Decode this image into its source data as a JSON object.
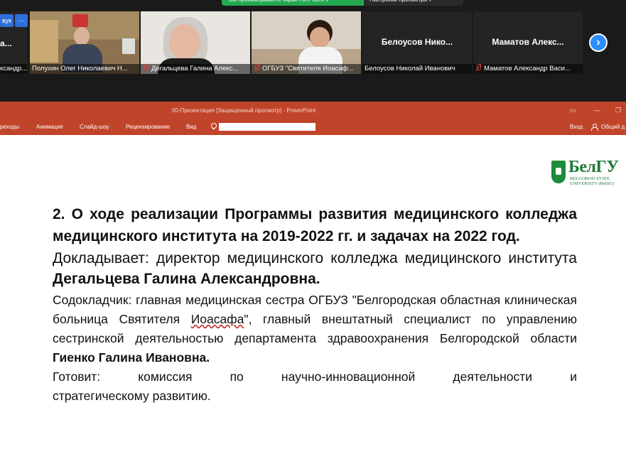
{
  "zoom": {
    "share_banner": "Вы просматриваете экран НИУ БелГУ",
    "view_options": "Настройки просмотра ▾",
    "top_left_btn": "вук",
    "top_left_more": "···",
    "side_tile_partial_top": "а...",
    "side_tile_partial_name": "ксандр...",
    "tiles": [
      {
        "name": "Полухин Олег Николаевич Н...",
        "muted": false,
        "active": true
      },
      {
        "name": "Дегальцева Галина Алекс...",
        "muted": true,
        "active": false
      },
      {
        "name": "ОГБУЗ \"Святителя Иоасаф...",
        "muted": true,
        "active": false
      },
      {
        "name": "Белоусов Николай Иванович",
        "center_label": "Белоусов Нико...",
        "muted": false,
        "active": false
      },
      {
        "name": "Маматов Александр Васи...",
        "center_label": "Маматов Алекс...",
        "muted": true,
        "active": false
      }
    ],
    "next_icon": "›"
  },
  "powerpoint": {
    "title": "00-Презентация [Защищенный просмотр] - PowerPoint",
    "ribbon_tabs": [
      "реходы",
      "Анимация",
      "Слайд-шоу",
      "Рецензирование",
      "Вид"
    ],
    "signin": "Вход",
    "share": "Общий д",
    "accent_color": "#c0442a"
  },
  "slide": {
    "logo": {
      "nriu": "НИУ",
      "main": "БелГУ",
      "sub": "BELGOROD STATE UNIVERSITY (BelSU)"
    },
    "heading": "2. О ходе реализации Программы развития медицинского колледжа медицинского института на 2019-2022 гг. и задачах на 2022 год.",
    "reporter_prefix": "Докладывает: директор медицинского колледжа медицинского института ",
    "reporter_name": "Дегальцева Галина Александровна.",
    "co_reporter_prefix": "Содокладчик: главная медицинская сестра ОГБУЗ \"Белгородская областная клиническая больница Святителя ",
    "co_reporter_saint": "Иоасафа",
    "co_reporter_mid": "\", главный внештатный специалист по управлению сестринской деятельностью департамента здравоохранения Белгородской области ",
    "co_reporter_name": "Гиенко Галина Ивановна.",
    "prepares_line1": "Готовит: комиссия по научно-инновационной деятельности и",
    "prepares_line2": "стратегическому развитию."
  }
}
